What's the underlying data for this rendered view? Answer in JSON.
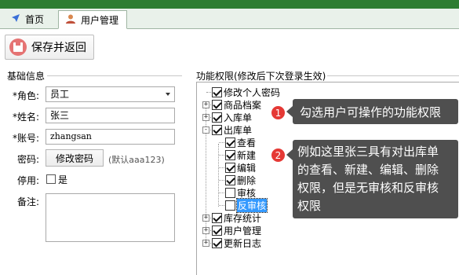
{
  "tabs": [
    {
      "label": "首页",
      "icon": "navigation-arrow-icon"
    },
    {
      "label": "用户管理",
      "icon": "user-icon"
    }
  ],
  "toolbar": {
    "save_label": "保存并返回",
    "save_icon": "floppy-disk-icon"
  },
  "basic_info": {
    "title": "基础信息",
    "role_label": "*角色:",
    "role_value": "员工",
    "name_label": "*姓名:",
    "name_value": "张三",
    "account_label": "*账号:",
    "account_value": "zhangsan",
    "password_label": "密码:",
    "password_button": "修改密码",
    "password_note": "(默认aaa123)",
    "disabled_label": "停用:",
    "disabled_option": "是",
    "remark_label": "备注:"
  },
  "permissions": {
    "title": "功能权限(修改后下次登录生效)",
    "nodes": [
      {
        "label": "修改个人密码",
        "checked": true
      },
      {
        "label": "商品档案",
        "checked": true,
        "expander": "+"
      },
      {
        "label": "入库单",
        "checked": true,
        "expander": "+"
      },
      {
        "label": "出库单",
        "checked": true,
        "expander": "-"
      },
      {
        "label": "查看",
        "checked": true
      },
      {
        "label": "新建",
        "checked": true
      },
      {
        "label": "编辑",
        "checked": true
      },
      {
        "label": "删除",
        "checked": true
      },
      {
        "label": "审核",
        "checked": false
      },
      {
        "label": "反审核",
        "checked": false,
        "selected": true
      },
      {
        "label": "库存统计",
        "checked": true,
        "expander": "+"
      },
      {
        "label": "用户管理",
        "checked": true,
        "expander": "+"
      },
      {
        "label": "更新日志",
        "checked": true,
        "expander": "+"
      }
    ]
  },
  "callouts": [
    {
      "num": "1",
      "text": "勾选用户可操作的功能权限"
    },
    {
      "num": "2",
      "lines": [
        "例如这里张三具有对出库单",
        "的查看、新建、编辑、删除",
        "权限，但是无审核和反审核",
        "权限"
      ]
    }
  ],
  "colors": {
    "accent_green": "#2e7d32",
    "callout_bg": "#4f4f4f",
    "badge_red": "#e53935",
    "selection_blue": "#3399ff"
  }
}
